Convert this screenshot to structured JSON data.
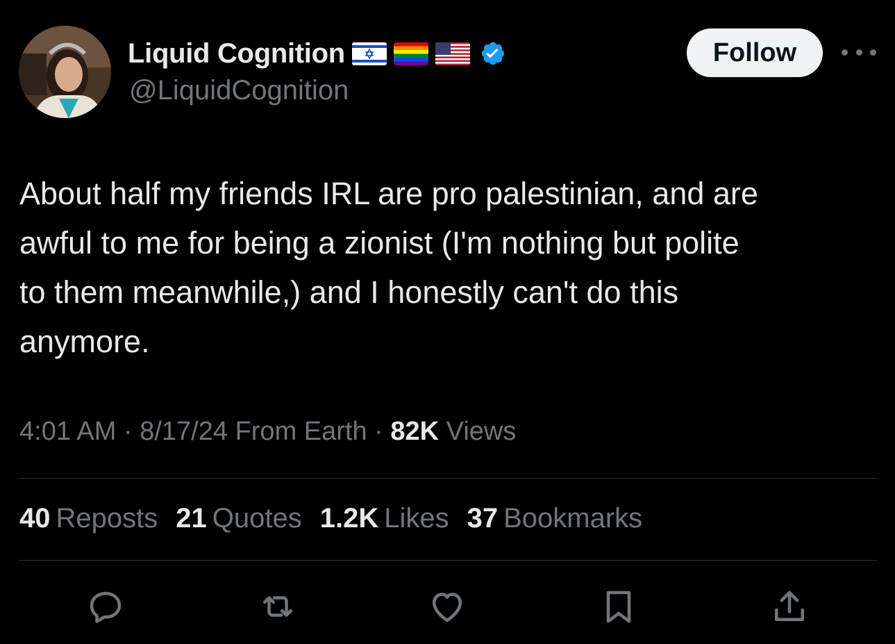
{
  "colors": {
    "background": "#000000",
    "text_primary": "#e7e9ea",
    "text_secondary": "#71767b",
    "divider": "#2f3336",
    "follow_bg": "#eff3f4",
    "verified_blue": "#1d9bf0"
  },
  "author": {
    "display_name": "Liquid Cognition",
    "handle": "@LiquidCognition",
    "flags": [
      "israel-flag-icon",
      "rainbow-pride-flag-icon",
      "usa-flag-icon"
    ],
    "verified_icon": "verified-badge-icon"
  },
  "follow_label": "Follow",
  "tweet": {
    "text": "About half my friends IRL are pro palestinian, and are\nawful to me for being a zionist (I'm nothing but polite\nto them meanwhile,) and I honestly can't do this\nanymore."
  },
  "meta": {
    "time": "4:01 AM",
    "sep1": "·",
    "date": "8/17/24",
    "location": "From Earth",
    "sep2": "·",
    "views_count": "82K",
    "views_label": "Views"
  },
  "stats": [
    {
      "count": "40",
      "label": "Reposts"
    },
    {
      "count": "21",
      "label": "Quotes"
    },
    {
      "count": "1.2K",
      "label": "Likes"
    },
    {
      "count": "37",
      "label": "Bookmarks"
    }
  ],
  "actions": [
    "reply-icon",
    "repost-icon",
    "like-icon",
    "bookmark-icon",
    "share-icon"
  ]
}
